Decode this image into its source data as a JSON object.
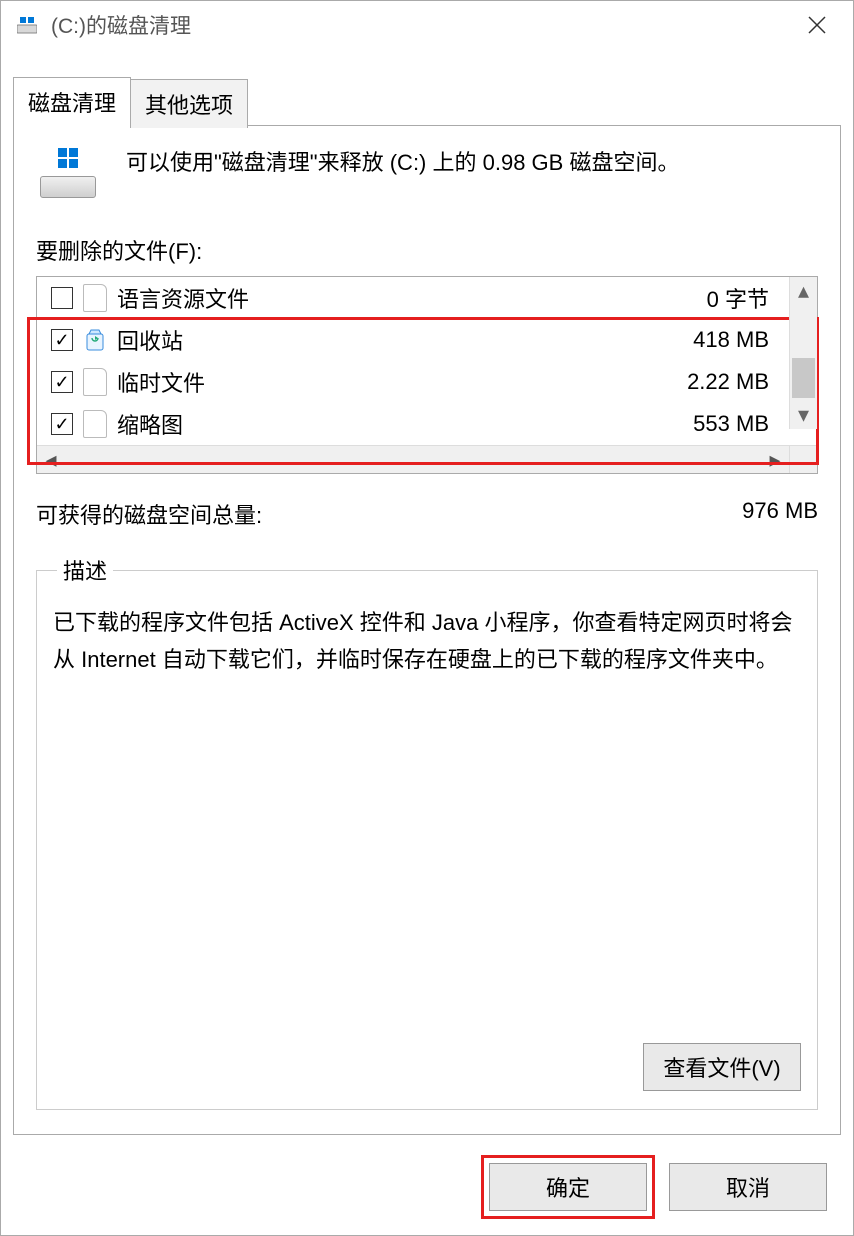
{
  "window": {
    "title": "(C:)的磁盘清理"
  },
  "tabs": {
    "cleanup": "磁盘清理",
    "other": "其他选项"
  },
  "intro": "可以使用\"磁盘清理\"来释放  (C:) 上的 0.98 GB 磁盘空间。",
  "files_section_label": "要删除的文件(F):",
  "files": [
    {
      "checked": false,
      "icon": "file",
      "name": "语言资源文件",
      "size": "0 字节"
    },
    {
      "checked": true,
      "icon": "recycle",
      "name": "回收站",
      "size": "418 MB"
    },
    {
      "checked": true,
      "icon": "file",
      "name": "临时文件",
      "size": "2.22 MB"
    },
    {
      "checked": true,
      "icon": "file",
      "name": "缩略图",
      "size": "553 MB"
    }
  ],
  "totals": {
    "label": "可获得的磁盘空间总量:",
    "value": "976 MB"
  },
  "description": {
    "legend": "描述",
    "text": "已下载的程序文件包括 ActiveX 控件和 Java 小程序，你查看特定网页时将会从 Internet 自动下载它们，并临时保存在硬盘上的已下载的程序文件夹中。",
    "view_files_btn": "查看文件(V)"
  },
  "buttons": {
    "ok": "确定",
    "cancel": "取消"
  }
}
